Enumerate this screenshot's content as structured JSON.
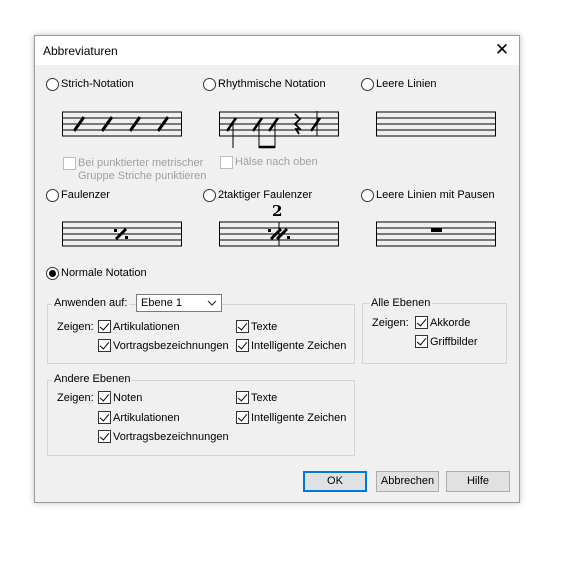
{
  "dialog": {
    "title": "Abbreviaturen",
    "close_icon": "close-icon"
  },
  "options": {
    "strich": {
      "label": "Strich-Notation",
      "checked": false
    },
    "rhythmisch": {
      "label": "Rhythmische Notation",
      "checked": false
    },
    "leere": {
      "label": "Leere Linien",
      "checked": false
    },
    "faulenzer": {
      "label": "Faulenzer",
      "checked": false
    },
    "faulenzer2": {
      "label": "2taktiger Faulenzer",
      "checked": false,
      "number": "2"
    },
    "leere_pausen": {
      "label": "Leere Linien mit Pausen",
      "checked": false
    },
    "normal": {
      "label": "Normale Notation",
      "checked": true
    }
  },
  "disabled_options": {
    "punktiert_line1": "Bei punktierter metrischer",
    "punktiert_line2": "Gruppe Striche punktieren",
    "haelse": "Hälse nach oben"
  },
  "apply": {
    "label": "Anwenden auf:",
    "selected": "Ebene 1",
    "zeigen": "Zeigen:",
    "artikulationen": "Artikulationen",
    "texte": "Texte",
    "vortrag": "Vortragsbezeichnungen",
    "intelligente": "Intelligente Zeichen"
  },
  "alle_ebenen": {
    "title": "Alle Ebenen",
    "zeigen": "Zeigen:",
    "akkorde": "Akkorde",
    "griffbilder": "Griffbilder"
  },
  "andere_ebenen": {
    "title": "Andere Ebenen",
    "zeigen": "Zeigen:",
    "noten": "Noten",
    "texte": "Texte",
    "artikulationen": "Artikulationen",
    "intelligente": "Intelligente Zeichen",
    "vortrag": "Vortragsbezeichnungen"
  },
  "buttons": {
    "ok": "OK",
    "cancel": "Abbrechen",
    "help": "Hilfe"
  },
  "colors": {
    "dialog_bg": "#f0f0f0",
    "default_button_border": "#0078d7"
  }
}
